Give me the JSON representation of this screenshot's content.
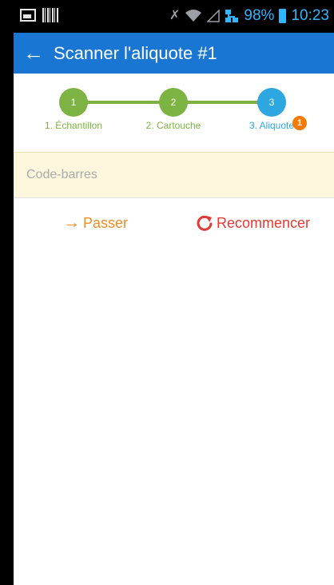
{
  "statusbar": {
    "battery_percent": "98%",
    "time": "10:23",
    "icons": [
      "image-icon",
      "barcode-icon",
      "mute-icon",
      "wifi-icon",
      "signal-icon",
      "network-icon",
      "battery-icon"
    ]
  },
  "appbar": {
    "title": "Scanner l'aliquote #1"
  },
  "stepper": {
    "steps": [
      {
        "number": "1",
        "label": "1. Échantillon",
        "state": "done",
        "color": "#7cb342"
      },
      {
        "number": "2",
        "label": "2. Cartouche",
        "state": "done",
        "color": "#7cb342"
      },
      {
        "number": "3",
        "label": "3. Aliquote",
        "state": "active",
        "color": "#2ea7e0"
      }
    ],
    "badge": "1"
  },
  "barcode": {
    "placeholder": "Code-barres",
    "value": ""
  },
  "actions": {
    "skip_label": "Passer",
    "restart_label": "Recommencer"
  },
  "colors": {
    "primary": "#1976d2",
    "step_done": "#7cb342",
    "step_active": "#2ea7e0",
    "badge": "#f57c00",
    "skip": "#f08c22",
    "restart": "#e53935",
    "input_bg": "#fcf6dc"
  }
}
